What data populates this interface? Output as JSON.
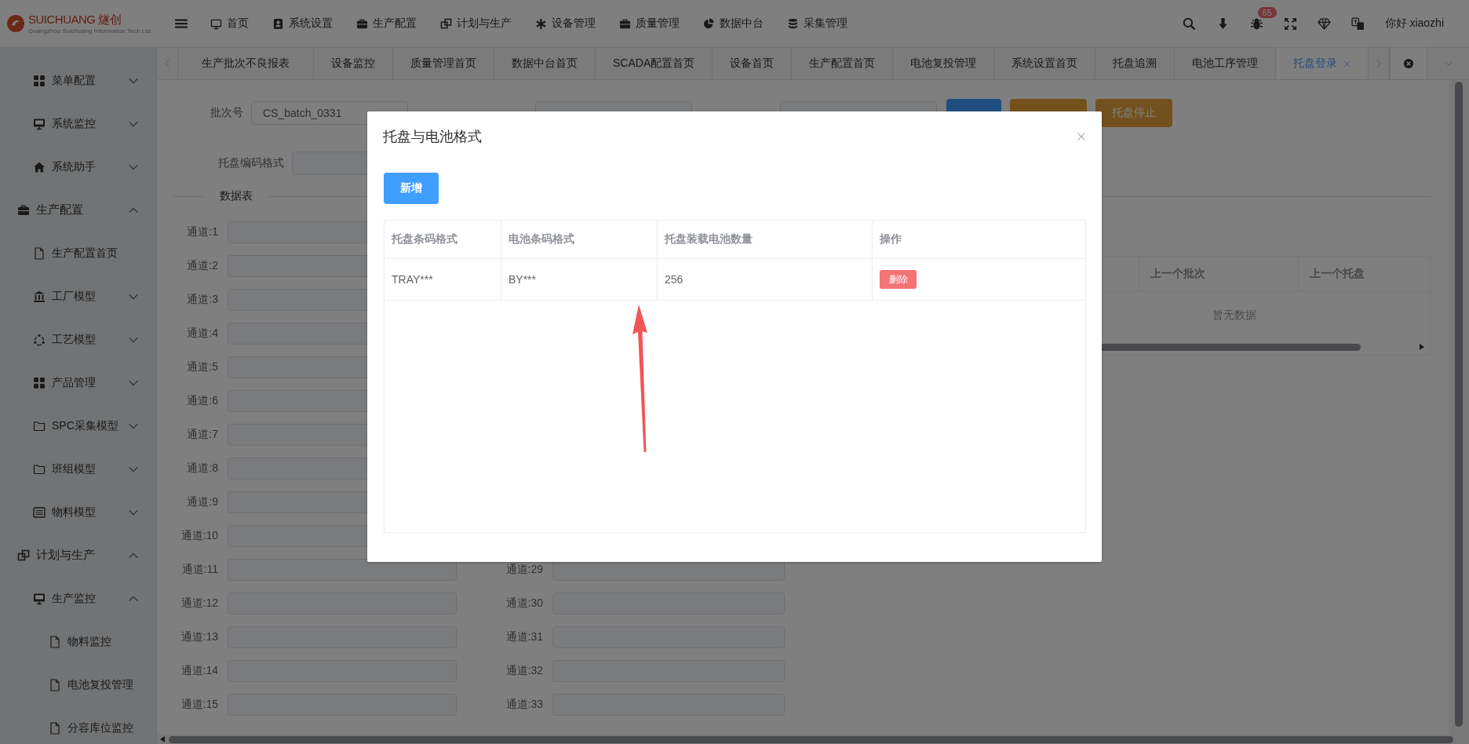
{
  "logo": {
    "brand": "SUICHUANG",
    "brand_cn": "燧创",
    "tagline": "Guangzhou Suichuang Information Tech Ltd"
  },
  "top_menu": [
    {
      "label": "首页"
    },
    {
      "label": "系统设置"
    },
    {
      "label": "生产配置"
    },
    {
      "label": "计划与生产"
    },
    {
      "label": "设备管理"
    },
    {
      "label": "质量管理"
    },
    {
      "label": "数据中台"
    },
    {
      "label": "采集管理"
    }
  ],
  "header_right": {
    "badge": "65",
    "greeting": "你好 xiaozhi"
  },
  "tabs": [
    {
      "label": "生产批次不良报表",
      "selected": false
    },
    {
      "label": "设备监控",
      "selected": false
    },
    {
      "label": "质量管理首页",
      "selected": false
    },
    {
      "label": "数据中台首页",
      "selected": false
    },
    {
      "label": "SCADA配置首页",
      "selected": false
    },
    {
      "label": "设备首页",
      "selected": false
    },
    {
      "label": "生产配置首页",
      "selected": false
    },
    {
      "label": "电池复投管理",
      "selected": false
    },
    {
      "label": "系统设置首页",
      "selected": false
    },
    {
      "label": "托盘追溯",
      "selected": false
    },
    {
      "label": "电池工序管理",
      "selected": false
    },
    {
      "label": "托盘登录",
      "selected": true
    }
  ],
  "sidebar": {
    "items": [
      {
        "children": [
          {
            "label": "菜单配置",
            "expanded": false
          },
          {
            "label": "系统监控",
            "expanded": false
          },
          {
            "label": "系统助手",
            "expanded": false
          }
        ]
      },
      {
        "label": "生产配置",
        "expanded": true,
        "children": [
          {
            "label": "生产配置首页"
          },
          {
            "label": "工厂模型",
            "expanded": false
          },
          {
            "label": "工艺模型",
            "expanded": false
          },
          {
            "label": "产品管理",
            "expanded": false
          },
          {
            "label": "SPC采集模型",
            "expanded": false
          },
          {
            "label": "班组模型",
            "expanded": false
          },
          {
            "label": "物料模型",
            "expanded": false
          }
        ]
      },
      {
        "label": "计划与生产",
        "expanded": true,
        "children": [
          {
            "label": "生产监控",
            "expanded": true,
            "children": [
              {
                "label": "物料监控"
              },
              {
                "label": "电池复投管理"
              },
              {
                "label": "分容库位监控"
              }
            ]
          }
        ]
      }
    ]
  },
  "form": {
    "fields": [
      {
        "label": "批次号",
        "value": "CS_batch_0331"
      },
      {
        "label": "托盘编码格式"
      }
    ],
    "buttons": [
      {
        "kind": "primary"
      },
      {
        "kind": "warning"
      },
      {
        "label": "托盘停止",
        "kind": "warning"
      }
    ]
  },
  "data_section": {
    "title": "数据表"
  },
  "channel_rows": [
    {
      "left": "通道:1"
    },
    {
      "left": "通道:2"
    },
    {
      "left": "通道:3"
    },
    {
      "left": "通道:4"
    },
    {
      "left": "通道:5"
    },
    {
      "left": "通道:6"
    },
    {
      "left": "通道:7"
    },
    {
      "left": "通道:8"
    },
    {
      "left": "通道:9"
    },
    {
      "left": "通道:10"
    },
    {
      "left": "通道:11",
      "right": "通道:29"
    },
    {
      "left": "通道:12",
      "right": "通道:30"
    },
    {
      "left": "通道:13",
      "right": "通道:31"
    },
    {
      "left": "通道:14",
      "right": "通道:32"
    },
    {
      "left": "通道:15",
      "right": "通道:33"
    }
  ],
  "side_table": {
    "columns": [
      "上一个批次",
      "上一个托盘"
    ],
    "empty_text": "暂无数据"
  },
  "dialog": {
    "title": "托盘与电池格式",
    "add_button": "新增",
    "columns": [
      "托盘条码格式",
      "电池条码格式",
      "托盘装载电池数量",
      "操作"
    ],
    "rows": [
      {
        "cells": [
          "TRAY***",
          "BY***",
          "256"
        ],
        "action": "删除"
      }
    ]
  }
}
